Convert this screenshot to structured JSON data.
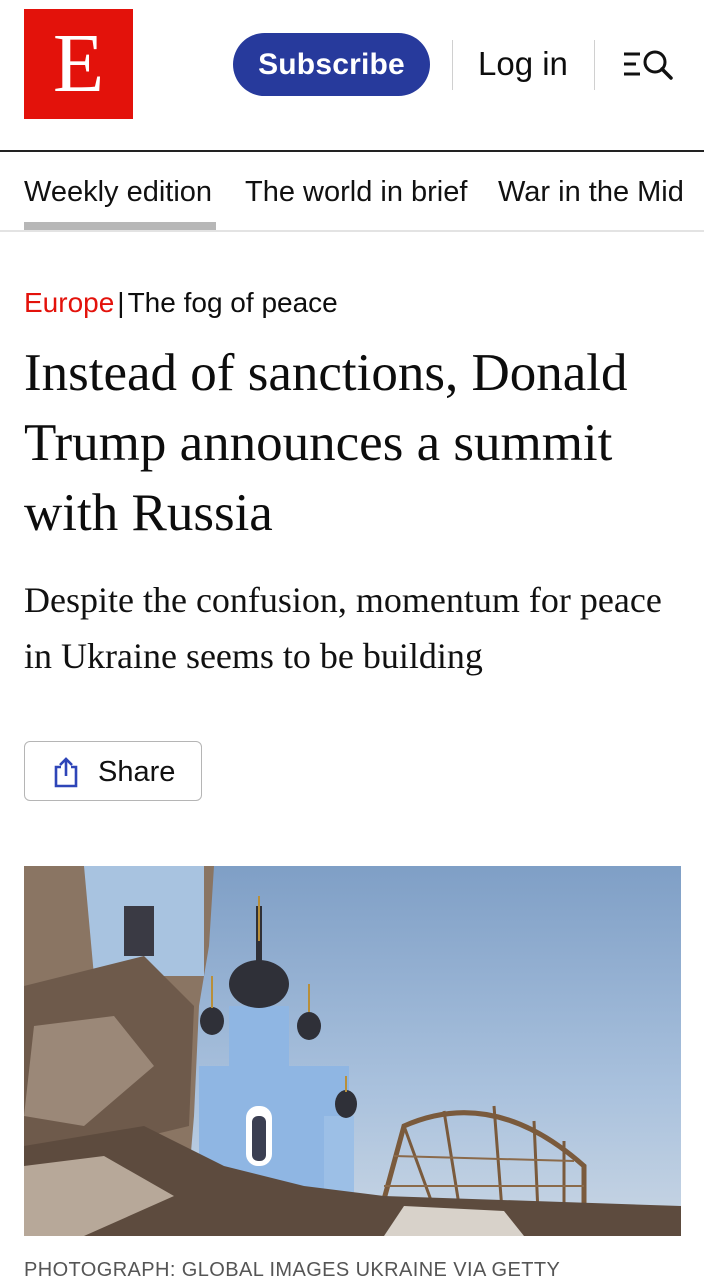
{
  "header": {
    "logo_letter": "E",
    "subscribe_label": "Subscribe",
    "login_label": "Log in",
    "menu_search_icon": "menu-search-icon"
  },
  "nav": {
    "items": [
      {
        "label": "Weekly edition",
        "active": true
      },
      {
        "label": "The world in brief",
        "active": false
      },
      {
        "label": "War in the Mid",
        "active": false
      }
    ]
  },
  "article": {
    "section": "Europe",
    "rubric": "The fog of peace",
    "headline": "Instead of sanctions, Donald Trump announces a summit with Russia",
    "standfirst": "Despite the confusion, momentum for peace in Ukraine seems to be building",
    "share_label": "Share",
    "share_icon": "share-icon",
    "photo_caption": "PHOTOGRAPH: GLOBAL IMAGES UKRAINE VIA GETTY"
  },
  "colors": {
    "brand_red": "#e3120b",
    "subscribe_blue": "#273a9c",
    "sky": "#a9c1dd",
    "church_blue": "#8fb6e3"
  }
}
